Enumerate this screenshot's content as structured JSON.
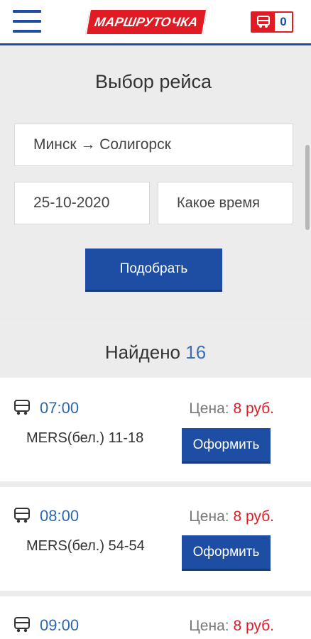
{
  "header": {
    "logo_text": "МАРШРУТОЧКА",
    "cart_count": "0"
  },
  "search": {
    "title": "Выбор рейса",
    "route": "Минск → Солигорск",
    "date": "25-10-2020",
    "time_placeholder": "Какое время",
    "submit_label": "Подобрать"
  },
  "results": {
    "found_label": "Найдено",
    "found_count": "16"
  },
  "trips": [
    {
      "time": "07:00",
      "vehicle": "MERS(бел.) 11-18",
      "price_label": "Цена:",
      "price_value": "8 руб.",
      "button_label": "Оформить"
    },
    {
      "time": "08:00",
      "vehicle": "MERS(бел.) 54-54",
      "price_label": "Цена:",
      "price_value": "8 руб.",
      "button_label": "Оформить"
    },
    {
      "time": "09:00",
      "vehicle": "",
      "price_label": "Цена:",
      "price_value": "8 руб.",
      "button_label": ""
    }
  ],
  "colors": {
    "brand_blue": "#1e4ea3",
    "brand_red": "#e01b24",
    "time_blue": "#2b67b0"
  }
}
